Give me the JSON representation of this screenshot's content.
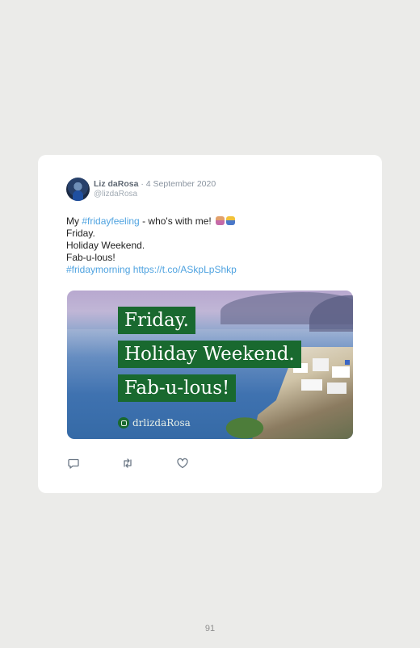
{
  "tweet": {
    "author_name": "Liz daRosa",
    "separator": " · ",
    "date": "4 September 2020",
    "handle": "@lizdaRosa",
    "lines": {
      "l1_prefix": "My ",
      "l1_hashtag": "#fridayfeeling",
      "l1_suffix": " - who's with me! ",
      "l2": "Friday.",
      "l3": "Holiday Weekend.",
      "l4": "Fab-u-lous!",
      "l5_hashtag": "#fridaymorning",
      "l5_link": "https://t.co/ASkpLpShkp"
    },
    "emoji_icons": [
      "woman-raising-hand-emoji",
      "person-raising-hand-emoji"
    ],
    "image": {
      "lines": [
        "Friday.",
        "Holiday Weekend.",
        "Fab-u-lous!"
      ],
      "watermark": "drlizdaRosa",
      "watermark_icon": "instagram-icon"
    },
    "actions": [
      "reply-icon",
      "retweet-icon",
      "like-icon"
    ]
  },
  "page": {
    "number": "91"
  },
  "colors": {
    "background": "#ebebe9",
    "card": "#ffffff",
    "link": "#4fa3e0",
    "banner": "#19692f"
  }
}
